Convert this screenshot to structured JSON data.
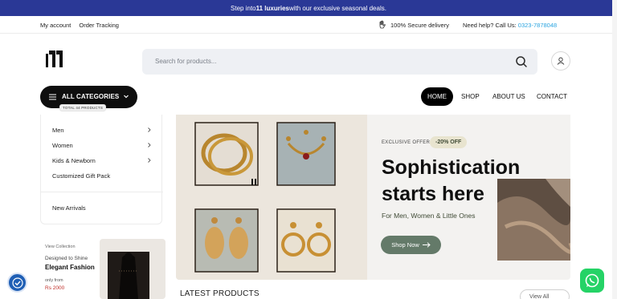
{
  "announcement": {
    "prefix": "Step into ",
    "brand": "11 luxuries",
    "suffix": " with our exclusive seasonal deals."
  },
  "utility": {
    "my_account": "My account",
    "order_tracking": "Order Tracking",
    "secure": "100% Secure delivery",
    "help_prefix": "Need help? Call Us: ",
    "phone": "0323-7878048"
  },
  "search": {
    "placeholder": "Search for products..."
  },
  "categories": {
    "button_label": "ALL CATEGORIES",
    "badge": "TOTAL 44 PRODUCTS",
    "items": [
      "Men",
      "Women",
      "Kids & Newborn",
      "Customized Gift Pack",
      "New Arrivals"
    ]
  },
  "nav": {
    "home": "HOME",
    "shop": "SHOP",
    "about": "ABOUT US",
    "contact": "CONTACT"
  },
  "promo": {
    "view": "View Collection",
    "tag": "Designed to Shine",
    "title": "Elegant Fashion",
    "only_from": "only from",
    "price": "Rs 2000"
  },
  "hero": {
    "offer": "EXCLUSIVE OFFER",
    "discount": "-20% OFF",
    "line1": "Sophistication",
    "line2": "starts here",
    "sub": "For Men, Women & Little Ones",
    "cta": "Shop Now"
  },
  "latest": {
    "title": "LATEST PRODUCTS",
    "view_all": "View All"
  },
  "colors": {
    "announcement_bg": "#2a3896",
    "phone": "#2aa4e0",
    "cta_bg": "#647a69",
    "price": "#c0302a",
    "whatsapp": "#25d366"
  },
  "icons": {
    "secure": "hand-shield-icon",
    "search": "search-icon",
    "account": "user-icon",
    "menu": "hamburger-icon",
    "chevron": "chevron-down-icon",
    "arrow": "arrow-right-icon",
    "accessibility": "accessibility-icon",
    "whatsapp": "whatsapp-icon"
  }
}
